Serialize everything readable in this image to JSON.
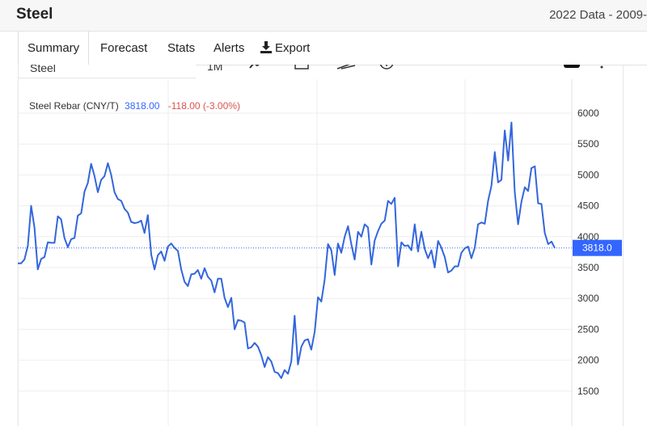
{
  "header": {
    "title": "Steel",
    "range": "2022 Data - 2009-"
  },
  "tabs": [
    {
      "label": "Summary",
      "active": true
    },
    {
      "label": "Forecast"
    },
    {
      "label": "Stats"
    },
    {
      "label": "Alerts"
    },
    {
      "label": "Export",
      "icon": "download-icon"
    }
  ],
  "toolbar": {
    "symbol_value": "Steel",
    "interval_label": "1M"
  },
  "legend": {
    "name": "Steel Rebar (CNY/T)",
    "last": "3818.00",
    "change": "-118.00 (-3.00%)"
  },
  "price_tag": "3818.0",
  "colors": {
    "line": "#3366dd",
    "price_tag": "#3366ff",
    "change_negative": "#d9534f"
  },
  "chart_data": {
    "type": "line",
    "y_ticks": [
      "6000",
      "5500",
      "5000",
      "4500",
      "4000",
      "3500",
      "3000",
      "2500",
      "2000",
      "1500"
    ],
    "ylim": [
      1150,
      6300
    ],
    "current_value": 3818,
    "series": [
      {
        "name": "Steel Rebar (CNY/T)",
        "values": [
          3570,
          3570,
          3630,
          3850,
          4500,
          4150,
          3470,
          3640,
          3670,
          3910,
          3900,
          3900,
          4330,
          4280,
          3980,
          3830,
          3960,
          3980,
          4340,
          4380,
          4730,
          4870,
          5180,
          4980,
          4720,
          4920,
          4980,
          5190,
          5000,
          4720,
          4610,
          4580,
          4450,
          4390,
          4240,
          4220,
          4230,
          4260,
          4060,
          4350,
          3710,
          3470,
          3700,
          3760,
          3610,
          3840,
          3890,
          3820,
          3770,
          3470,
          3270,
          3200,
          3390,
          3400,
          3460,
          3320,
          3490,
          3350,
          3290,
          3100,
          3320,
          3320,
          3010,
          2860,
          3010,
          2500,
          2650,
          2640,
          2610,
          2190,
          2210,
          2280,
          2220,
          2080,
          1890,
          2050,
          1980,
          1810,
          1790,
          1710,
          1840,
          1780,
          1980,
          2720,
          1930,
          2220,
          2320,
          2340,
          2170,
          2460,
          3020,
          2950,
          3300,
          3880,
          3780,
          3380,
          3890,
          3740,
          4000,
          4170,
          3880,
          3630,
          4080,
          4000,
          4200,
          4150,
          3550,
          3940,
          4090,
          4210,
          4260,
          4580,
          4530,
          4630,
          3520,
          3910,
          3850,
          3860,
          3780,
          4200,
          3760,
          4080,
          3800,
          3650,
          3780,
          3500,
          3930,
          3820,
          3670,
          3420,
          3450,
          3520,
          3520,
          3740,
          3810,
          3840,
          3650,
          3820,
          4200,
          4230,
          4210,
          4580,
          4820,
          5370,
          4880,
          4920,
          5720,
          5230,
          5850,
          4720,
          4200,
          4570,
          4800,
          4740,
          5110,
          5140,
          4540,
          4530,
          4060,
          3880,
          3920,
          3818
        ]
      }
    ]
  }
}
